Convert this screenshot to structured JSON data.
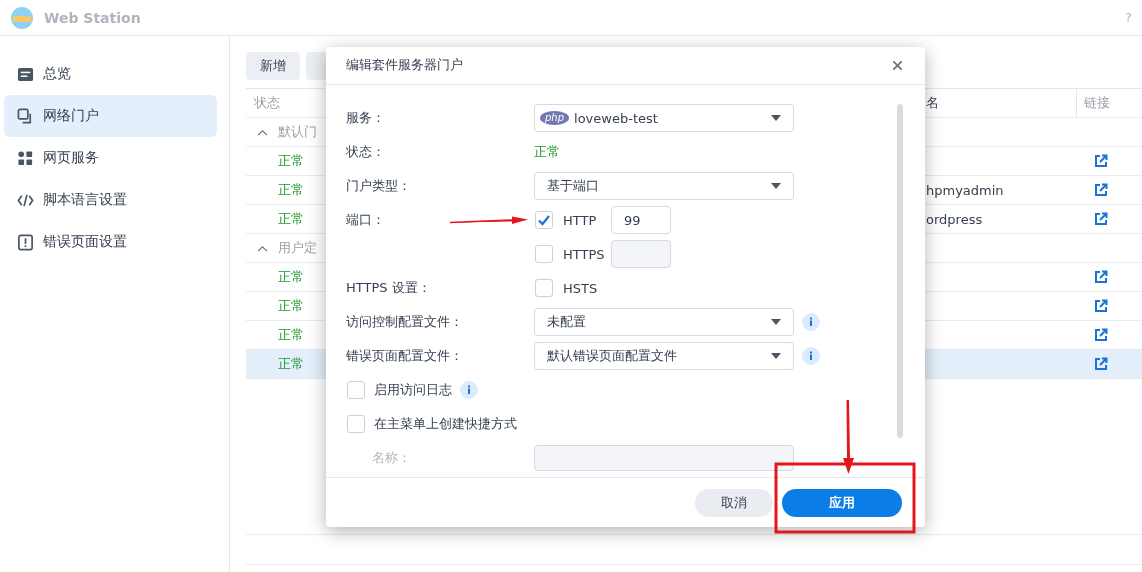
{
  "app": {
    "title": "Web Station",
    "help": "?"
  },
  "sidebar": {
    "items": [
      {
        "label": "总览",
        "selected": false
      },
      {
        "label": "网络门户",
        "selected": true
      },
      {
        "label": "网页服务",
        "selected": false
      },
      {
        "label": "脚本语言设置",
        "selected": false
      },
      {
        "label": "错误页面设置",
        "selected": false
      }
    ]
  },
  "toolbar": {
    "buttons": [
      "新增"
    ]
  },
  "table": {
    "columns": [
      "状态",
      "名",
      "链接"
    ],
    "groups": [
      {
        "label": "默认门",
        "expanded": true,
        "rows": [
          {
            "status": "正常",
            "selected": false
          },
          {
            "status": "正常",
            "alias": "hpmyadmin",
            "selected": false
          },
          {
            "status": "正常",
            "alias": "ordpress",
            "selected": false
          }
        ]
      },
      {
        "label": "用户定",
        "expanded": true,
        "rows": [
          {
            "status": "正常",
            "selected": false
          },
          {
            "status": "正常",
            "selected": false
          },
          {
            "status": "正常",
            "selected": false
          },
          {
            "status": "正常",
            "selected": true
          }
        ]
      }
    ]
  },
  "dialog": {
    "title": "编辑套件服务器门户",
    "fields": [
      {
        "kind": "select",
        "label": "服务：",
        "value": "loveweb-test",
        "badge": "php"
      },
      {
        "kind": "status",
        "label": "状态：",
        "value": "正常"
      },
      {
        "kind": "select",
        "label": "门户类型：",
        "value": "基于端口"
      },
      {
        "kind": "ports",
        "label": "端口：",
        "options": [
          {
            "label": "HTTP",
            "checked": true,
            "value": "99"
          },
          {
            "label": "HTTPS",
            "checked": false
          }
        ]
      },
      {
        "kind": "checks",
        "label": "HTTPS 设置：",
        "options": [
          {
            "label": "HSTS",
            "checked": false
          }
        ]
      },
      {
        "kind": "select",
        "label": "访问控制配置文件：",
        "value": "未配置",
        "info": true
      },
      {
        "kind": "select",
        "label": "错误页面配置文件：",
        "value": "默认错误页面配置文件",
        "info": true
      },
      {
        "kind": "check",
        "label": "启用访问日志",
        "checked": false,
        "info": true
      },
      {
        "kind": "check",
        "label": "在主菜单上创建快捷方式",
        "checked": false
      },
      {
        "kind": "input",
        "label": "名称：",
        "disabled": true
      }
    ],
    "buttons": [
      {
        "label": "取消",
        "kind": "secondary"
      },
      {
        "label": "应用",
        "kind": "primary"
      }
    ]
  }
}
